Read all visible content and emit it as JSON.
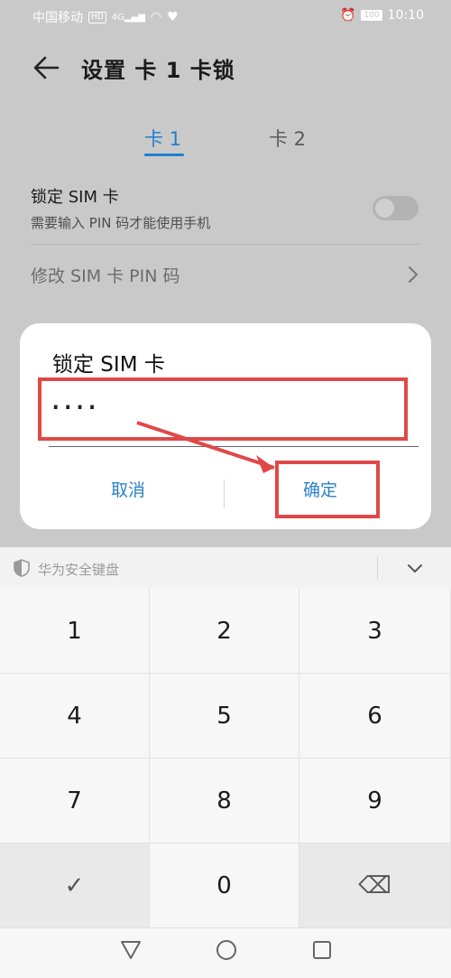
{
  "status_bar": {
    "carrier": "中国移动",
    "network": "HD",
    "signal": "4G",
    "battery": "100",
    "time": "10:10"
  },
  "header": {
    "title": "设置 卡 1 卡锁"
  },
  "tabs": [
    {
      "label": "卡 1",
      "active": true
    },
    {
      "label": "卡 2",
      "active": false
    }
  ],
  "lock_sim": {
    "title": "锁定 SIM 卡",
    "subtitle": "需要输入 PIN 码才能使用手机",
    "enabled": false
  },
  "change_pin": {
    "label": "修改 SIM 卡 PIN 码"
  },
  "dialog": {
    "title": "锁定 SIM 卡",
    "pin_value": "····",
    "cancel_label": "取消",
    "ok_label": "确定"
  },
  "keyboard": {
    "label": "华为安全键盘",
    "keys": [
      "1",
      "2",
      "3",
      "4",
      "5",
      "6",
      "7",
      "8",
      "9",
      "✓",
      "0",
      "⌫"
    ]
  },
  "colors": {
    "accent": "#1e7fce",
    "highlight": "#e04848"
  }
}
